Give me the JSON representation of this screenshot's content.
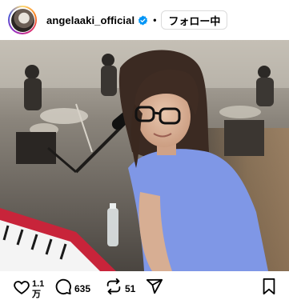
{
  "header": {
    "username": "angelaaki_official",
    "verified_icon": "verified-badge-icon",
    "separator": "•",
    "follow_label": "フォロー中"
  },
  "actions": {
    "likes_top": "1.1",
    "likes_bottom": "万",
    "comments": "635",
    "reposts": "51",
    "icons": [
      "heart-icon",
      "comment-icon",
      "repost-icon",
      "share-icon",
      "bookmark-icon"
    ]
  },
  "colors": {
    "verified": "#0095f6",
    "shirt": "#7f97e6",
    "keyboard": "#c8243a"
  }
}
